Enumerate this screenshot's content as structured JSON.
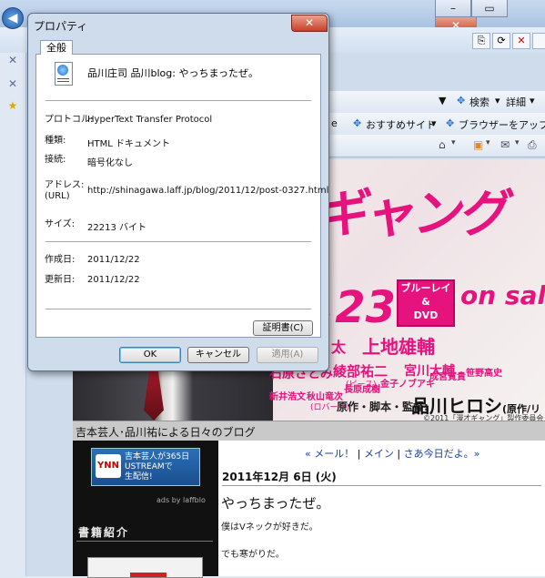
{
  "dialog": {
    "title": "プロパティ",
    "close_label": "✕",
    "tab": "全般",
    "page_name": "品川庄司 品川blog: やっちまったぜ。",
    "fields": {
      "protocol_label": "プロトコル:",
      "protocol_value": "HyperText Transfer Protocol",
      "type_label": "種類:",
      "type_value": "HTML ドキュメント",
      "connection_label": "接続:",
      "connection_value": "暗号化なし",
      "address_label": "アドレス:",
      "address_label2": "(URL)",
      "address_value": "http://shinagawa.laff.jp/blog/2011/12/post-0327.html",
      "size_label": "サイズ:",
      "size_value": "22213 バイト",
      "created_label": "作成日:",
      "created_value": "2011/12/22",
      "updated_label": "更新日:",
      "updated_value": "2011/12/22"
    },
    "certificate_button": "証明書(C)",
    "ok_button": "OK",
    "cancel_button": "キャンセル",
    "apply_button": "適用(A)"
  },
  "browser": {
    "search_label": "検索",
    "detail_label": "詳細",
    "fav_partial": "e",
    "fav_recommended": "おすすめサイト",
    "fav_browser_app": "ブラウザーをアップ..."
  },
  "poster": {
    "title_partial": "オギャング",
    "date_partial": ".23",
    "bluray_line1": "ブルーレイ",
    "bluray_line2": "&",
    "bluray_line3": "DVD",
    "on_sale": "on sale",
    "cast_a": "太",
    "cast_b": "上地雄輔",
    "cast_c": "石原さとみ",
    "cast_d": "綾部祐二",
    "cast_d_sub": "(ピース)",
    "cast_e": "宮川大輔",
    "cast_f": "新井浩文",
    "cast_g": "秋山竜次",
    "cast_g_sub": "(ロバート)",
    "cast_h": "長原成樹",
    "cast_i": "金子ノブアキ",
    "cast_j": "成宮寛貴",
    "cast_k": "笹野高史",
    "credits_label": "原作・脚本・監督:",
    "credits_name": "品川ヒロシ",
    "credits_suffix": "(原作/リ",
    "copyright": "©2011「漫才ギャング」製作委員会"
  },
  "blog": {
    "header": "吉本芸人･品川祐による日々のブログ",
    "ad_text1": "吉本芸人が365日",
    "ad_text2": "USTREAMで",
    "ad_text3": "生配信!",
    "ad_logo": "YNN",
    "ads_by": "ads by laffblo",
    "book_section": "書籍紹介",
    "nav_prev": "« メール！",
    "nav_sep1": " | ",
    "nav_main": "メイン",
    "nav_sep2": " | ",
    "nav_next": "さあ今日だよ。»",
    "post_date": "2011年12月 6日 (火)",
    "post_title": "やっちまったぜ。",
    "post_line1": "僕はVネックが好きだ。",
    "post_line2": "でも寒がりだ。"
  }
}
